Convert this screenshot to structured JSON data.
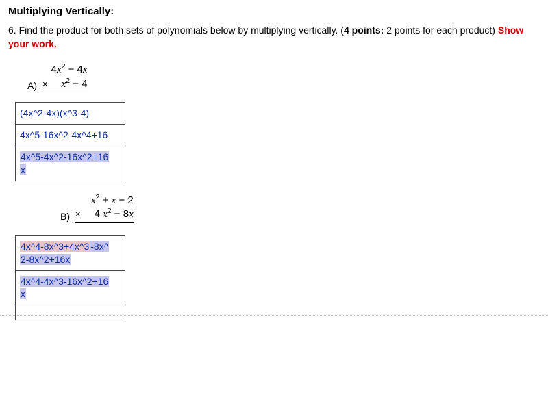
{
  "heading": "Multiplying Vertically:",
  "question": {
    "prefix": "6. Find the product for both sets of polynomials below by multiplying vertically. (",
    "points_bold": "4 points:",
    "points_rest": " 2 points for each product) ",
    "red": "Show your work."
  },
  "problems": {
    "A": {
      "label": "A)",
      "line1_parts": [
        "4",
        "x",
        "2",
        " − 4",
        "x"
      ],
      "line2_parts": [
        "x",
        "2",
        " − 4"
      ],
      "answers": [
        {
          "segments": [
            {
              "text": "(4x^2-4x)(x^3-4)",
              "hl": "none"
            }
          ]
        },
        {
          "segments": [
            {
              "text": "4x^5-16x^2-4x^4+16",
              "hl": "none"
            }
          ]
        },
        {
          "segments": [
            {
              "text": "4x^5-4x^2-16x^2+16",
              "hl": "purple"
            },
            {
              "text": "x",
              "hl": "purple",
              "br_before": true
            }
          ]
        }
      ]
    },
    "B": {
      "label": "B)",
      "line1_parts": [
        "x",
        "2",
        " + ",
        "x",
        " − 2"
      ],
      "line2_parts": [
        "4 ",
        "x",
        "2",
        " − 8",
        "x"
      ],
      "answers": [
        {
          "segments": [
            {
              "text": "4x^4-8x^3+4x^3",
              "hl": "pink"
            },
            {
              "text": "-8x^",
              "hl": "purple"
            },
            {
              "text": "2-8x^2+16x",
              "hl": "purple",
              "br_before": true
            }
          ]
        },
        {
          "segments": [
            {
              "text": "4x^4-4x^3-16x^2+16",
              "hl": "purple"
            },
            {
              "text": "x",
              "hl": "purple",
              "br_before": true
            }
          ]
        },
        {
          "segments": []
        }
      ]
    }
  }
}
